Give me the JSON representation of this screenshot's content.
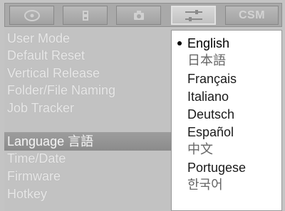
{
  "tabs": [
    {
      "icon": "disc-icon"
    },
    {
      "icon": "film-icon"
    },
    {
      "icon": "camera-icon"
    },
    {
      "icon": "settings-sliders-icon",
      "active": true
    },
    {
      "label": "CSM"
    }
  ],
  "menu": {
    "items": [
      "User Mode",
      "Default Reset",
      "Vertical Release",
      "Folder/File Naming",
      "Job Tracker",
      "Language 言語",
      "Time/Date",
      "Firmware",
      "Hotkey"
    ],
    "selected_index": 5
  },
  "languages": {
    "items": [
      "English",
      "日本語",
      "Français",
      "Italiano",
      "Deutsch",
      "Español",
      "中文",
      "Portugese",
      "한국어"
    ],
    "selected_index": 0
  },
  "colors": {
    "background": "#c4c4c4",
    "popup": "#ffffff",
    "selected_row": "#8e8e8e",
    "menu_text": "#e7e7e7"
  }
}
